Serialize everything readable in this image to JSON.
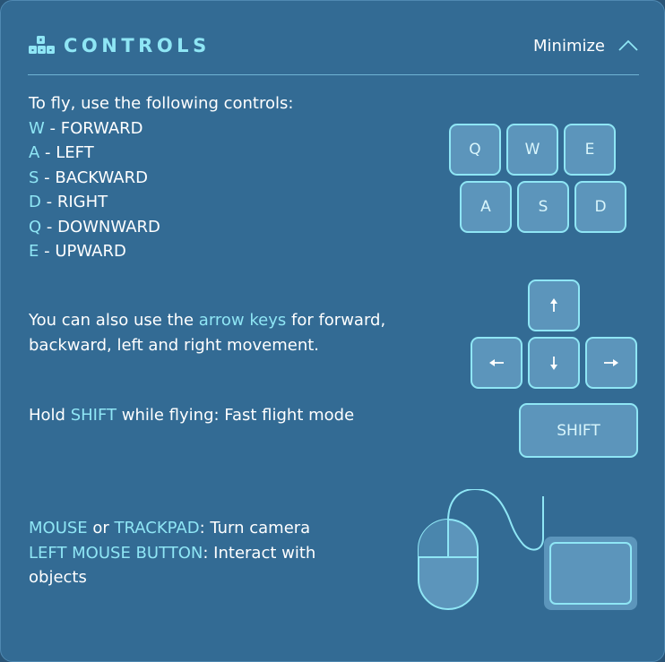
{
  "header": {
    "title": "CONTROLS",
    "minimize_label": "Minimize",
    "icons": {
      "logo": "keyboard-keys-icon",
      "toggle": "chevron-up-icon"
    }
  },
  "fly": {
    "intro": "To fly, use the following controls:",
    "controls": [
      {
        "key": "W",
        "action": " - FORWARD"
      },
      {
        "key": "A",
        "action": " - LEFT"
      },
      {
        "key": "S",
        "action": " - BACKWARD"
      },
      {
        "key": "D",
        "action": " - RIGHT"
      },
      {
        "key": "Q",
        "action": " - DOWNWARD"
      },
      {
        "key": "E",
        "action": " - UPWARD"
      }
    ]
  },
  "keys": {
    "q": "Q",
    "w": "W",
    "e": "E",
    "a": "A",
    "s": "S",
    "d": "D",
    "shift": "SHIFT"
  },
  "arrows": {
    "line1_pre": "You can also use the ",
    "line1_hl": "arrow keys",
    "line1_post": " for forward,",
    "line2": "backward, left and right movement.",
    "icons": [
      "arrow-up-icon",
      "arrow-left-icon",
      "arrow-down-icon",
      "arrow-right-icon"
    ]
  },
  "shift": {
    "pre": "Hold ",
    "hl": "SHIFT",
    "post": " while flying: Fast flight mode"
  },
  "mouse": {
    "line1_hl1": "MOUSE",
    "line1_mid": " or ",
    "line1_hl2": "TRACKPAD",
    "line1_post": ": Turn camera",
    "line2_hl": "LEFT MOUSE BUTTON",
    "line2_post": ": Interact with",
    "line3": "objects",
    "icons": [
      "mouse-icon",
      "trackpad-icon"
    ]
  },
  "colors": {
    "panel": "#336b94",
    "accent": "#8fe6f5",
    "key_fill": "#5c95bb",
    "text": "#ffffff"
  }
}
